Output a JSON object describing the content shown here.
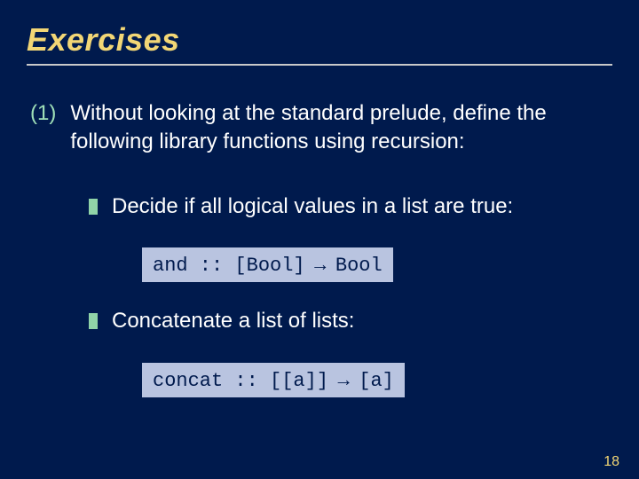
{
  "title": "Exercises",
  "item": {
    "number": "(1)",
    "text": "Without looking at the standard prelude, define the following library functions using recursion:"
  },
  "sub1": {
    "text": "Decide if all logical values in a list are true:",
    "code_fn": "and",
    "code_sep": " :: ",
    "code_in": "[Bool]",
    "code_arrow": " → ",
    "code_out": "Bool"
  },
  "sub2": {
    "text": "Concatenate a list of lists:",
    "code_fn": "concat",
    "code_sep": " :: ",
    "code_in": "[[a]]",
    "code_arrow": " → ",
    "code_out": "[a]"
  },
  "page_number": "18"
}
